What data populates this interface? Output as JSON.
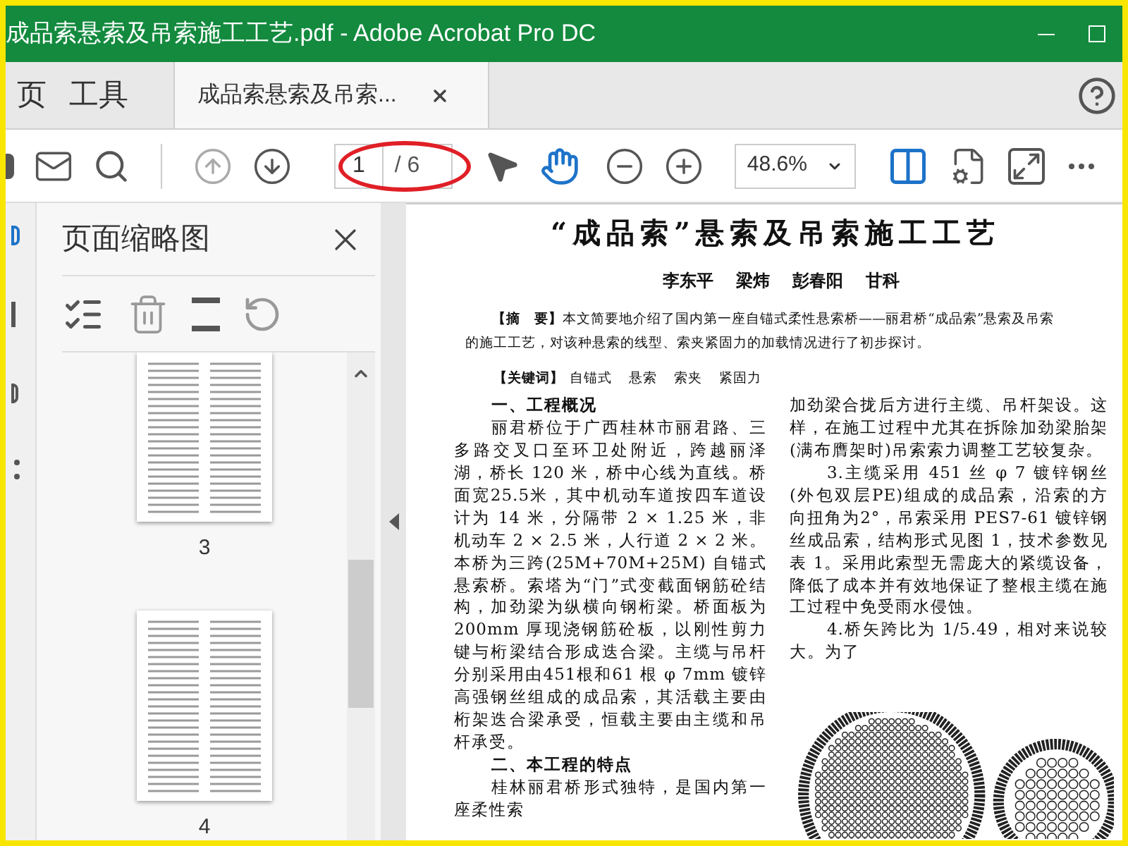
{
  "window": {
    "title": "成品索悬索及吊索施工工艺.pdf - Adobe Acrobat Pro DC"
  },
  "tabs": [
    {
      "kind": "nav",
      "label": "页",
      "selected": false
    },
    {
      "kind": "nav",
      "label": "工具",
      "selected": false
    },
    {
      "kind": "document",
      "label": "成品索悬索及吊索...",
      "selected": true
    }
  ],
  "toolbar": {
    "page_input": "1",
    "page_total": "/ 6",
    "zoom": "48.6%"
  },
  "thumbnails_panel": {
    "title": "页面缩略图",
    "pages": [
      {
        "label": "3",
        "selected": false
      },
      {
        "label": "4",
        "selected": false
      }
    ]
  },
  "document": {
    "title": "“成品索”悬索及吊索施工工艺",
    "authors": [
      "李东平",
      "梁炜",
      "彭春阳",
      "甘科"
    ],
    "abstract_label": "【摘　要】",
    "abstract": "本文简要地介绍了国内第一座自锚式柔性悬索桥——丽君桥“成品索”悬索及吊索的施工工艺，对该种悬索的线型、索夹紧固力的加载情况进行了初步探讨。",
    "keywords_label": "【关键词】",
    "keywords": [
      "自锚式",
      "悬索",
      "索夹",
      "紧固力"
    ],
    "left_column": [
      {
        "kind": "heading",
        "text": "一、工程概况"
      },
      {
        "kind": "paragraph",
        "text": "丽君桥位于广西桂林市丽君路、三多路交叉口至环卫处附近，跨越丽泽湖，桥长 120 米，桥中心线为直线。桥面宽25.5米，其中机动车道按四车道设计为 14 米，分隔带 2 × 1.25 米，非机动车 2 × 2.5 米，人行道 2 × 2 米。本桥为三跨(25M+70M+25M) 自锚式悬索桥。索塔为“门”式变截面钢筋砼结构，加劲梁为纵横向钢桁梁。桥面板为 200mm 厚现浇钢筋砼板，以刚性剪力键与桁梁结合形成迭合梁。主缆与吊杆分别采用由451根和61 根 φ 7mm 镀锌高强钢丝组成的成品索，其活载主要由桁架迭合梁承受，恒载主要由主缆和吊杆承受。"
      },
      {
        "kind": "heading",
        "text": "二、本工程的特点"
      },
      {
        "kind": "paragraph",
        "text": "桂林丽君桥形式独特，是国内第一座柔性索"
      }
    ],
    "right_column": [
      {
        "kind": "continued",
        "text": "加劲梁合拢后方进行主缆、吊杆架设。这样，在施工过程中尤其在拆除加劲梁胎架(满布膺架时)吊索索力调整工艺较复杂。"
      },
      {
        "kind": "paragraph",
        "text": "3.主缆采用 451 丝 φ 7 镀锌钢丝 (外包双层PE)组成的成品索，沿索的方向扭角为2°，吊索采用 PES7-61 镀锌钢丝成品索，结构形式见图 1，技术参数见表 1。采用此索型无需庞大的紧缆设备，降低了成本并有效地保证了整根主缆在施工过程中免受雨水侵蚀。"
      },
      {
        "kind": "paragraph",
        "text": "4.桥矢跨比为 1/5.49，相对来说较大。为了"
      }
    ]
  }
}
